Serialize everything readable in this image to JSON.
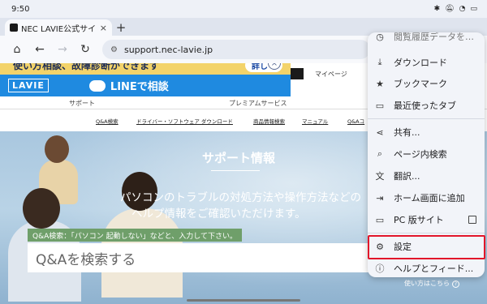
{
  "status": {
    "time": "9:50",
    "icons": [
      "bluetooth-icon",
      "bell-off-icon",
      "wifi-icon",
      "battery-icon"
    ]
  },
  "tabs": [
    {
      "title": "NEC LAVIE公式サイ",
      "close": "×"
    }
  ],
  "newtab_symbol": "+",
  "toolbar": {
    "url": "support.nec-lavie.jp"
  },
  "page": {
    "promo_text": "使い方相談、故障診断ができます",
    "promo_button": "詳しく",
    "logo": "LAVIE",
    "line_consult": "LINEで相談",
    "mypage": "マイページ",
    "subnav": [
      "サポート",
      "プレミアムサービス"
    ],
    "links": [
      "Q&A検索",
      "ドライバー・ソフトウェア ダウンロード",
      "商品情報検索",
      "マニュアル",
      "Q&Aコ"
    ],
    "hero_title": "サポート情報",
    "hero_desc_1": "パソコンのトラブルの対処方法や操作方法などの",
    "hero_desc_2": "ヘルプ情報をご確認いただけます。",
    "search_hint": "Q&A検索：「パソコン 起動しない」などと、入力して下さい。",
    "search_placeholder": "Q&Aを検索する",
    "howto": "使い方はこちら"
  },
  "menu": {
    "cut_item": "閲覧履歴データを…",
    "items": [
      {
        "label": "ダウンロード",
        "icon": "download-icon"
      },
      {
        "label": "ブックマーク",
        "icon": "star-icon"
      },
      {
        "label": "最近使ったタブ",
        "icon": "recent-tabs-icon"
      },
      {
        "label": "共有...",
        "icon": "share-icon"
      },
      {
        "label": "ページ内検索",
        "icon": "find-in-page-icon"
      },
      {
        "label": "翻訳...",
        "icon": "translate-icon"
      },
      {
        "label": "ホーム画面に追加",
        "icon": "add-to-home-icon"
      },
      {
        "label": "PC 版サイト",
        "icon": "desktop-icon",
        "checked": false
      },
      {
        "label": "設定",
        "icon": "gear-icon",
        "highlighted": true
      },
      {
        "label": "ヘルプとフィード...",
        "icon": "help-icon"
      }
    ]
  },
  "highlight_color": "#e2162a"
}
